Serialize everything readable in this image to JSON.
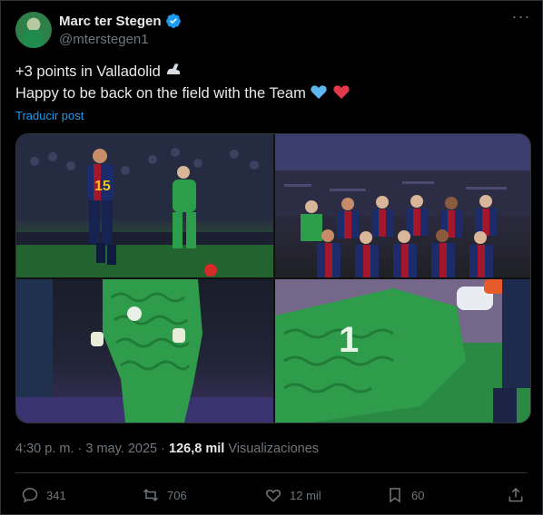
{
  "author": {
    "name": "Marc ter Stegen",
    "handle": "@mterstegen1"
  },
  "tweet": {
    "line1": "+3 points in Valladolid",
    "line2": "Happy to be back on the field with the Team",
    "translate_label": "Traducir post"
  },
  "media": {
    "images": [
      {
        "icon": "photo-player-with-ball"
      },
      {
        "icon": "photo-team-lineup"
      },
      {
        "icon": "photo-goalkeeper-back"
      },
      {
        "icon": "photo-goalkeeper-closeup"
      }
    ]
  },
  "meta": {
    "time": "4:30 p. m.",
    "sep": "·",
    "date": "3 may. 2025",
    "views_count": "126,8 mil",
    "views_label": "Visualizaciones"
  },
  "actions": {
    "replies": "341",
    "reposts": "706",
    "likes": "12 mil",
    "bookmarks": "60"
  },
  "colors": {
    "background": "#000000",
    "text": "#e7e9ea",
    "muted": "#71767b",
    "link": "#1d9bf0",
    "verified": "#1d9bf0"
  }
}
